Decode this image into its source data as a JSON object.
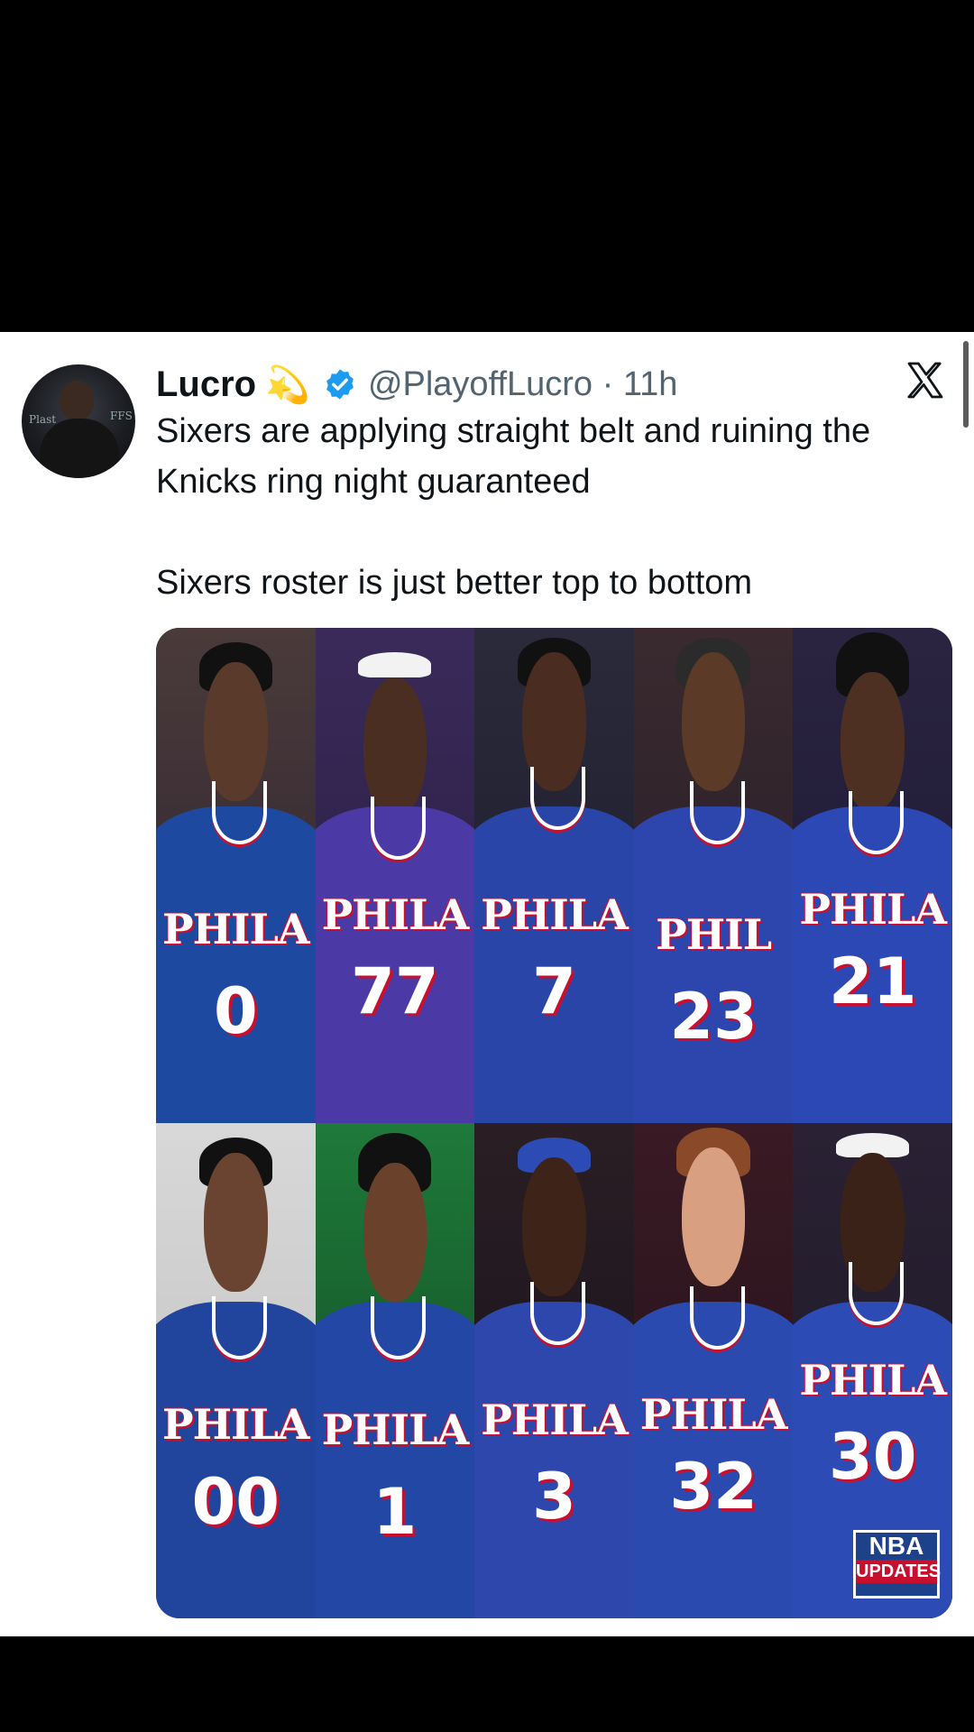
{
  "caption": "😂😂😂😂😂😂😂😂",
  "tweet": {
    "author_name": "Lucro",
    "author_badge_emoji": "💫",
    "handle_time": "@PlayoffLucro · 11h",
    "text_line1": "Sixers are applying straight belt and ruining the Knicks ring night guaranteed",
    "text_line2": "Sixers roster is just better top to bottom"
  },
  "players_top": [
    {
      "word": "PHILA",
      "number": "0",
      "jersey_color": "#1d4aa0"
    },
    {
      "word": "PHILA",
      "number": "77",
      "jersey_color": "#4b3aa6"
    },
    {
      "word": "PHILA",
      "number": "7",
      "jersey_color": "#2a45a8"
    },
    {
      "word": "PHIL",
      "number": "23",
      "jersey_color": "#2c46ad"
    },
    {
      "word": "PHILA",
      "number": "21",
      "jersey_color": "#2b48b4"
    }
  ],
  "players_bottom": [
    {
      "word": "PHILA",
      "number": "00",
      "jersey_color": "#21459c"
    },
    {
      "word": "PHILA",
      "number": "1",
      "jersey_color": "#2347a4"
    },
    {
      "word": "PHILA",
      "number": "3",
      "jersey_color": "#2e47ad"
    },
    {
      "word": "PHILA",
      "number": "32",
      "jersey_color": "#2b4ab0"
    },
    {
      "word": "PHILA",
      "number": "30",
      "jersey_color": "#2d4bb4"
    }
  ],
  "badge": {
    "line1": "NBA",
    "line2": "UPDATES"
  }
}
